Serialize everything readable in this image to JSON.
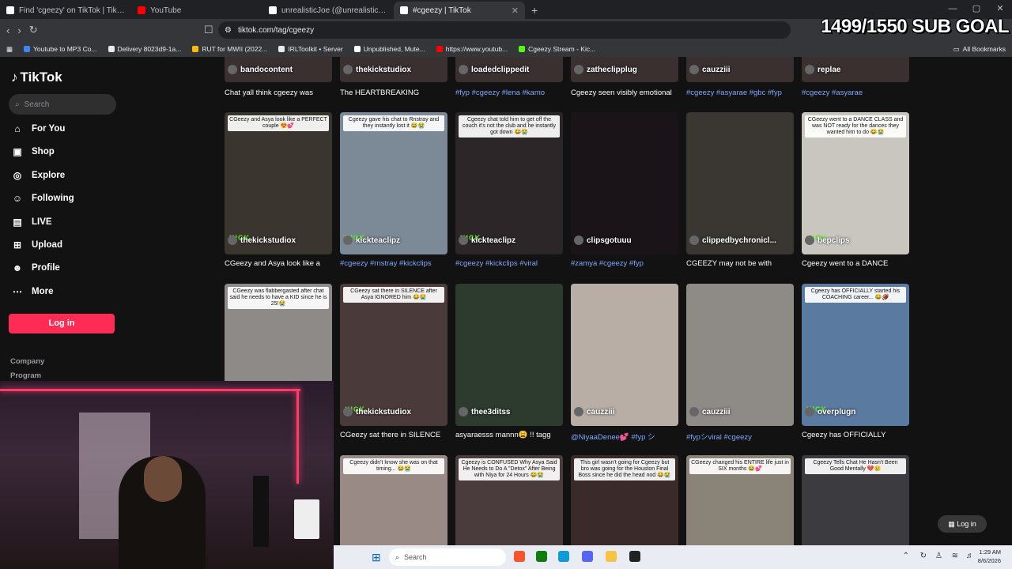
{
  "browser": {
    "tabs": [
      {
        "title": "Find 'cgeezy' on TikTok | TikTok Searc",
        "color": "#ffffff",
        "active": false
      },
      {
        "title": "YouTube",
        "color": "#ff0000",
        "active": false
      },
      {
        "title": "unrealisticJoe (@unrealisticjoe) | TikT",
        "color": "#ffffff",
        "active": false
      },
      {
        "title": "#cgeezy | TikTok",
        "color": "#ffffff",
        "active": true
      }
    ],
    "url": "tiktok.com/tag/cgeezy",
    "bookmarks": [
      {
        "label": "Youtube to MP3 Co...",
        "color": "#4285f4"
      },
      {
        "label": "Delivery 8023d9-1a...",
        "color": "#e8eaed"
      },
      {
        "label": "RUT for MWII (2022...",
        "color": "#fbbc04"
      },
      {
        "label": "IRLToolkit • Server",
        "color": "#e8eaed"
      },
      {
        "label": "Unpublished, Mute...",
        "color": "#ffffff"
      },
      {
        "label": "https://www.youtub...",
        "color": "#ff0000"
      },
      {
        "label": "Cgeezy Stream - Kic...",
        "color": "#53fc18"
      }
    ],
    "all_bookmarks": "All Bookmarks"
  },
  "overlay": {
    "sub_goal": "1499/1550 SUB GOAL"
  },
  "sidebar": {
    "logo": "TikTok",
    "search_placeholder": "Search",
    "items": [
      {
        "label": "For You",
        "icon": "home-icon",
        "glyph": "⌂"
      },
      {
        "label": "Shop",
        "icon": "shop-icon",
        "glyph": "▣"
      },
      {
        "label": "Explore",
        "icon": "compass-icon",
        "glyph": "◎"
      },
      {
        "label": "Following",
        "icon": "following-icon",
        "glyph": "☺"
      },
      {
        "label": "LIVE",
        "icon": "live-icon",
        "glyph": "▤"
      },
      {
        "label": "Upload",
        "icon": "upload-icon",
        "glyph": "⊞"
      },
      {
        "label": "Profile",
        "icon": "profile-icon",
        "glyph": "☻"
      },
      {
        "label": "More",
        "icon": "more-icon",
        "glyph": "⋯"
      }
    ],
    "login": "Log in",
    "footer": [
      "Company",
      "Program"
    ]
  },
  "videos_row0": [
    {
      "author": "bandocontent",
      "desc": "Chat yall think cgeezy was",
      "tag": false
    },
    {
      "author": "thekickstudiox",
      "desc": "The HEARTBREAKING",
      "tag": false
    },
    {
      "author": "loadedclippedit",
      "desc": "#fyp #cgeezy #lena #kamo",
      "tag": true
    },
    {
      "author": "zatheclipplug",
      "desc": "Cgeezy seen visibly emotional",
      "tag": false
    },
    {
      "author": "cauzziii",
      "desc": "#cgeezy #asyarae #gbc #fyp",
      "tag": true
    },
    {
      "author": "replae",
      "desc": "#cgeezy #asyarae",
      "tag": true
    }
  ],
  "videos_row1": [
    {
      "author": "thekickstudiox",
      "desc": "CGeezy and Asya look like a",
      "tag": false,
      "caption": "CGeezy and Asya look like a PERFECT couple 😍💕",
      "kick": true,
      "bg": "#3b3530"
    },
    {
      "author": "kickteaclipz",
      "desc": "#cgeezy #rnstray #kickclips",
      "tag": true,
      "caption": "Cgeezy gave his chat to Rnstray and they instantly lost it 😂😭",
      "kick": true,
      "bg": "#7c8a98"
    },
    {
      "author": "kickteaclipz",
      "desc": "#cgeezy #kickclips #viral",
      "tag": true,
      "caption": "Cgeezy chat told him to get off the couch it's not the club and he instantly got down 😂😭",
      "kick": true,
      "bg": "#2c2628"
    },
    {
      "author": "clipsgotuuu",
      "desc": "#zamya #cgeezy #fyp",
      "tag": true,
      "caption": "",
      "kick": false,
      "bg": "#1a1418"
    },
    {
      "author": "clippedbychronicl...",
      "desc": "CGEEZY may not be with",
      "tag": false,
      "caption": "",
      "kick": false,
      "bg": "#3a3632"
    },
    {
      "author": "bepclips",
      "desc": "Cgeezy went to a DANCE",
      "tag": false,
      "caption": "CGeezy went to a DANCE CLASS and was NOT ready for the dances they wanted him to do 😂😭",
      "kick": true,
      "bg": "#c9c6c0"
    }
  ],
  "videos_row2": [
    {
      "author": "",
      "desc": "",
      "tag": false,
      "caption": "CGeezy was flabbergasted after chat said he needs to have a KID since he is 25!😭",
      "kick": false,
      "bg": "#8d8a88"
    },
    {
      "author": "thekickstudiox",
      "desc": "CGeezy sat there in SILENCE",
      "tag": false,
      "caption": "CGeezy sat there in SILENCE after Asya IGNORED him 😂😭",
      "kick": true,
      "bg": "#4a3a3a"
    },
    {
      "author": "thee3ditss",
      "desc": "asyaraesss mannn😩 !! tagg",
      "tag": false,
      "caption": "",
      "kick": false,
      "bg": "#2d3a2e"
    },
    {
      "author": "cauzziii",
      "desc": "@NiyaaDenee💕 #fyp シ",
      "tag": true,
      "caption": "",
      "kick": false,
      "bg": "#b8aea6"
    },
    {
      "author": "cauzziii",
      "desc": "#fypシviral #cgeezy",
      "tag": true,
      "caption": "",
      "kick": false,
      "bg": "#8e8a86"
    },
    {
      "author": "overplugn",
      "desc": "Cgeezy has OFFICIALLY",
      "tag": false,
      "caption": "Cgeezy has OFFICIALLY started his COACHING career... 😂🏈",
      "kick": true,
      "bg": "#5a7aa0"
    }
  ],
  "videos_row3": [
    {
      "caption": "Cgeezy didn't know she was on that timing... 😂😭",
      "bg": "#9a8a86"
    },
    {
      "caption": "Cgeezy is CONFUSED Why Asya Said He Needs to Do A \"Detox\" After Being with Niya for 24 Hours 😂😭",
      "bg": "#4a3c3c"
    },
    {
      "caption": "This girl wasn't going for Cgeezy but bro was going for the Houston Final Boss since he did the head nod 😂😭",
      "bg": "#3a2a2a"
    },
    {
      "caption": "CGeezy changed his ENTIRE life just in SIX months 😂💕",
      "bg": "#8a8478"
    },
    {
      "caption": "Cgeezy Tells Chat He Hasn't Been Good Mentally 💔😢",
      "bg": "#3c3c40"
    }
  ],
  "floating_login": "Log in",
  "taskbar": {
    "search": "Search",
    "time": "1:29 AM",
    "date": "8/6/2026"
  }
}
